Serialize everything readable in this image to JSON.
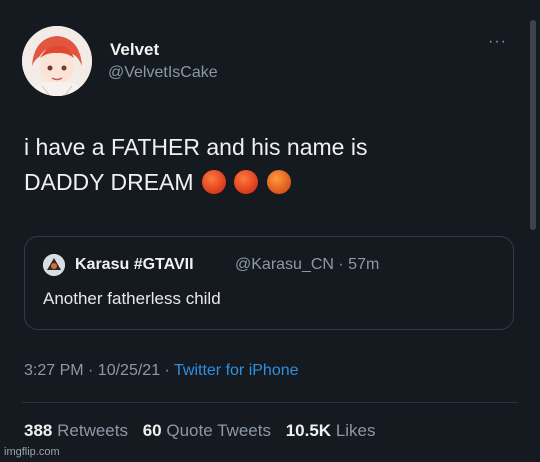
{
  "tweet": {
    "author_name": "Velvet",
    "author_handle": "@VelvetIsCake",
    "more_icon": "more-dots-icon",
    "text_line1": "i have a FATHER and his name is",
    "text_line2": "DADDY DREAM",
    "emojis": [
      "angry-face-icon",
      "angry-face-icon",
      "face-with-symbols-icon"
    ]
  },
  "quoted_tweet": {
    "author_name": "Karasu #GTAVII",
    "author_handle_time": "@Karasu_CN · 57m",
    "text": "Another fatherless child"
  },
  "meta": {
    "time_date": "3:27 PM · 10/25/21 ·",
    "app": "Twitter for iPhone"
  },
  "stats": {
    "retweets_count": "388",
    "retweets_label": "Retweets",
    "quotes_count": "60",
    "quotes_label": "Quote Tweets",
    "likes_count": "10.5K",
    "likes_label": "Likes"
  },
  "watermark": "imgflip.com",
  "colors": {
    "background": "#151a21",
    "link_blue": "#2f8fdd",
    "muted_gray": "#8b98a5"
  }
}
